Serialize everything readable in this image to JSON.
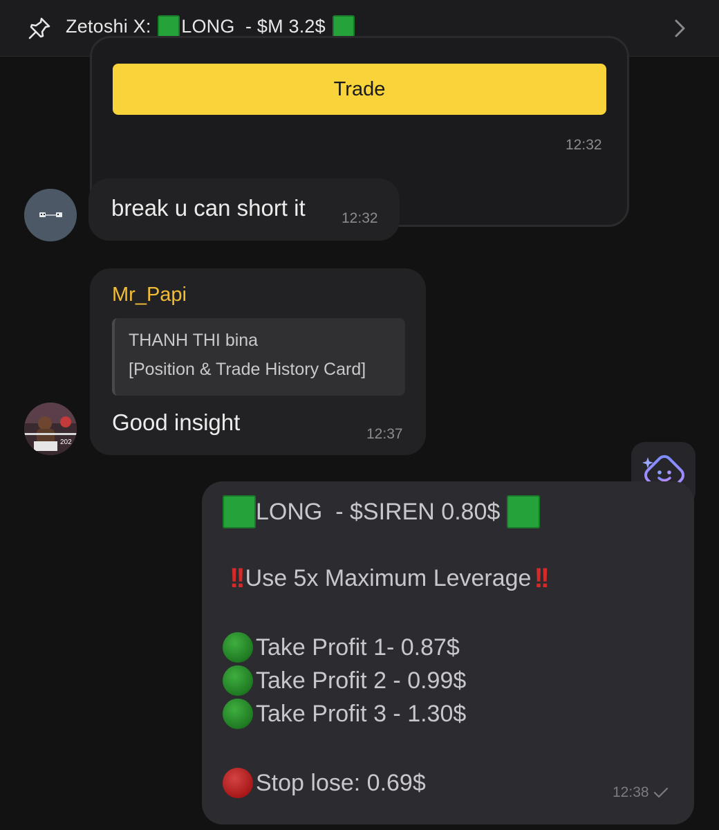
{
  "pinned": {
    "prefix": "Zetoshi X: ",
    "title": "LONG  - $M 3.2$ "
  },
  "card": {
    "button_label": "Trade",
    "time": "12:32"
  },
  "messages": [
    {
      "text": "break u can short it",
      "time": "12:32"
    },
    {
      "sender": "Mr_Papi",
      "reply_author": "THANH THI bina",
      "reply_text": "[Position & Trade History Card]",
      "text": "Good insight",
      "time": "12:37"
    }
  ],
  "outgoing": {
    "headline": "LONG  - $SIREN 0.80$ ",
    "leverage": "Use 5x Maximum Leverage",
    "tp1": "Take Profit 1- 0.87$",
    "tp2": "Take Profit 2 - 0.99$",
    "tp3": "Take Profit 3 - 1.30$",
    "stop": "Stop lose: 0.69$",
    "time": "12:38"
  },
  "colors": {
    "accent_yellow": "#f8d33a",
    "sender_name": "#f2bd35",
    "green_emoji": "#25a33a",
    "red_emoji": "#c62020"
  },
  "icons": [
    "pin-icon",
    "chevron-right-icon",
    "bot-face-icon",
    "read-check-icon"
  ]
}
